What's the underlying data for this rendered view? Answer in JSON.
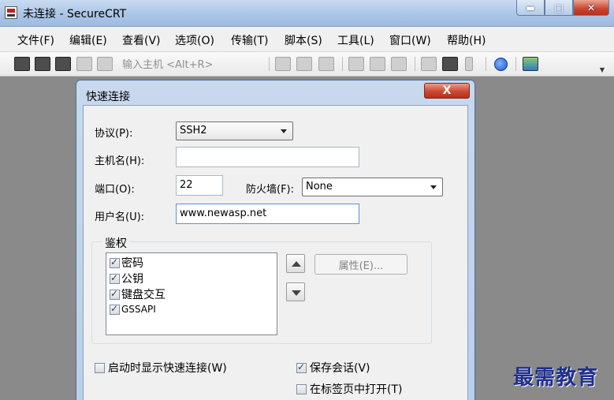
{
  "window": {
    "title": "未连接 - SecureCRT",
    "min_label": "▬",
    "max_label": "□",
    "close_label": "✕"
  },
  "menu": [
    "文件(F)",
    "编辑(E)",
    "查看(V)",
    "选项(O)",
    "传输(T)",
    "脚本(S)",
    "工具(L)",
    "窗口(W)",
    "帮助(H)"
  ],
  "toolbar": {
    "host_hint": "输入主机 <Alt+R>",
    "overflow_label": "▼"
  },
  "dialog": {
    "title": "快速连接",
    "close_label": "X",
    "protocol_label": "协议(P):",
    "protocol_value": "SSH2",
    "hostname_label": "主机名(H):",
    "hostname_value": "",
    "port_label": "端口(O):",
    "port_value": "22",
    "firewall_label": "防火墙(F):",
    "firewall_value": "None",
    "username_label": "用户名(U):",
    "username_value": "www.newasp.net",
    "auth_group_label": "鉴权",
    "auth_methods": [
      {
        "label": "密码",
        "checked": true
      },
      {
        "label": "公钥",
        "checked": true
      },
      {
        "label": "键盘交互",
        "checked": true
      },
      {
        "label": "GSSAPI",
        "checked": true
      }
    ],
    "properties_label": "属性(E)...",
    "show_on_startup_label": "启动时显示快速连接(W)",
    "show_on_startup_checked": false,
    "save_session_label": "保存会话(V)",
    "save_session_checked": true,
    "open_in_tab_label": "在标签页中打开(T)",
    "open_in_tab_checked": false
  },
  "watermark": "最需教育"
}
